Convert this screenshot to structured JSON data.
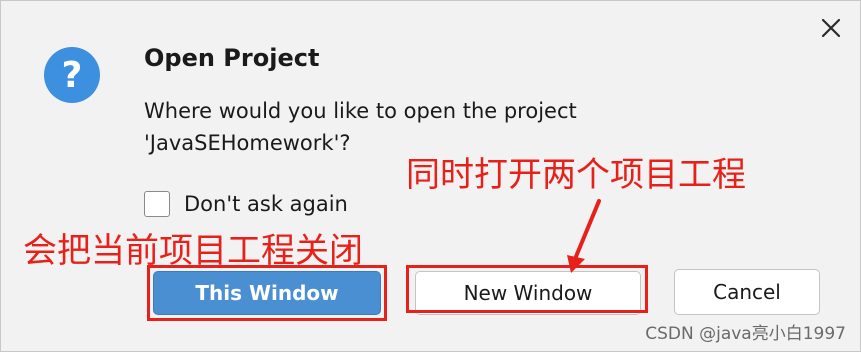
{
  "dialog": {
    "title": "Open Project",
    "message": "Where would you like to open the project 'JavaSEHomework'?",
    "checkbox_label": "Don't ask again",
    "buttons": {
      "this_window": "This Window",
      "new_window": "New Window",
      "cancel": "Cancel"
    },
    "icons": {
      "dialog_icon": "question-icon",
      "close": "close-icon"
    }
  },
  "annotations": {
    "new_window_note": "同时打开两个项目工程",
    "this_window_note": "会把当前项目工程关闭"
  },
  "watermark": "CSDN @java亮小白1997",
  "colors": {
    "primary_button": "#4a8fd1",
    "annotation_red": "#e8201a",
    "question_icon": "#3d8fe0"
  }
}
